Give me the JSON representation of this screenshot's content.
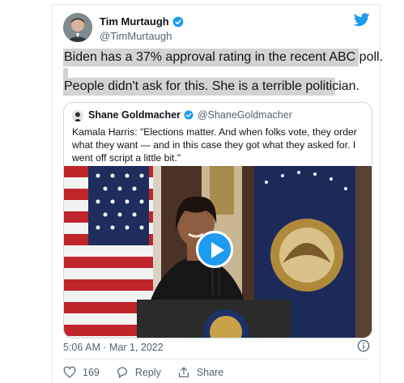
{
  "tweet": {
    "author_name": "Tim Murtaugh",
    "author_handle": "@TimMurtaugh",
    "text_line1": "Biden has a 37% approval rating in the recent ABC poll.",
    "text_line2": "People didn't ask for this. She is a terrible politician.",
    "timestamp": "5:06 AM · Mar 1, 2022",
    "like_count": "169",
    "reply_label": "Reply",
    "share_label": "Share"
  },
  "quoted": {
    "author_name": "Shane Goldmacher",
    "author_handle": "@ShaneGoldmacher",
    "text": "Kamala Harris: \"Elections matter. And when folks vote, they order what they want — and in this case they got what they asked for. I went off script a little bit.\""
  },
  "colors": {
    "accent": "#1d9bf0",
    "highlight": "#d3d3d3"
  },
  "icons": [
    "verified-badge-icon",
    "twitter-logo-icon",
    "play-icon",
    "info-icon",
    "heart-icon",
    "reply-icon",
    "share-icon"
  ]
}
